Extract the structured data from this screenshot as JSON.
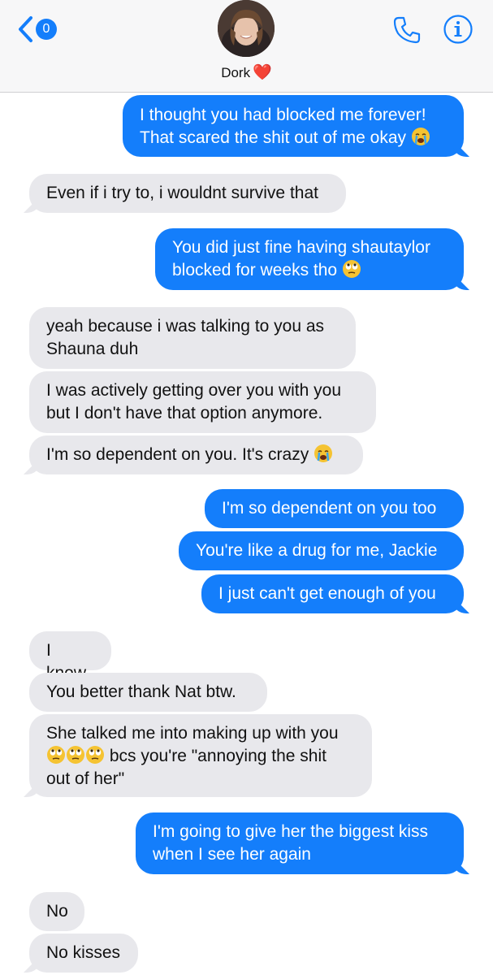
{
  "header": {
    "unread_count": "0",
    "contact_name": "Dork",
    "contact_emoji": "❤️"
  },
  "icons": {
    "back": "chevron-left-icon",
    "phone": "phone-icon",
    "info": "info-icon"
  },
  "colors": {
    "sent_bubble": "#147efb",
    "received_bubble": "#e8e8ec",
    "accent": "#147efb"
  },
  "messages": [
    {
      "from": "me",
      "lines": [
        "I thought you had blocked me forever!",
        "That scared the shit out of me okay"
      ],
      "emoji_end": "crying-face"
    },
    {
      "from": "them",
      "lines": [
        "Even if i try to, i wouldnt survive that"
      ]
    },
    {
      "from": "me",
      "lines": [
        "You did just fine having shautaylor",
        "blocked for weeks tho"
      ],
      "emoji_end": "eye-roll-face"
    },
    {
      "from": "them",
      "lines": [
        "yeah because i was talking to you as",
        "Shauna duh"
      ]
    },
    {
      "from": "them",
      "lines": [
        "I was actively getting over you with you",
        "but I don't have that option anymore."
      ]
    },
    {
      "from": "them",
      "lines": [
        "I'm so dependent on you. It's crazy"
      ],
      "emoji_end": "crying-face"
    },
    {
      "from": "me",
      "lines": [
        "I'm so dependent on you too"
      ]
    },
    {
      "from": "me",
      "lines": [
        "You're like a drug for me, Jackie"
      ]
    },
    {
      "from": "me",
      "lines": [
        "I just can't get enough of you"
      ]
    },
    {
      "from": "them",
      "lines": [
        "I know"
      ]
    },
    {
      "from": "them",
      "lines": [
        "You better thank Nat btw."
      ]
    },
    {
      "from": "them",
      "lines": [
        "She talked me into making up with you",
        "bcs you're \"annoying the shit",
        "out of her\""
      ],
      "emoji_start_line2": "eye-roll-face x3"
    },
    {
      "from": "me",
      "lines": [
        "I'm going to give her the biggest kiss",
        "when I see her again"
      ]
    },
    {
      "from": "them",
      "lines": [
        "No"
      ]
    },
    {
      "from": "them",
      "lines": [
        "No kisses"
      ]
    }
  ]
}
